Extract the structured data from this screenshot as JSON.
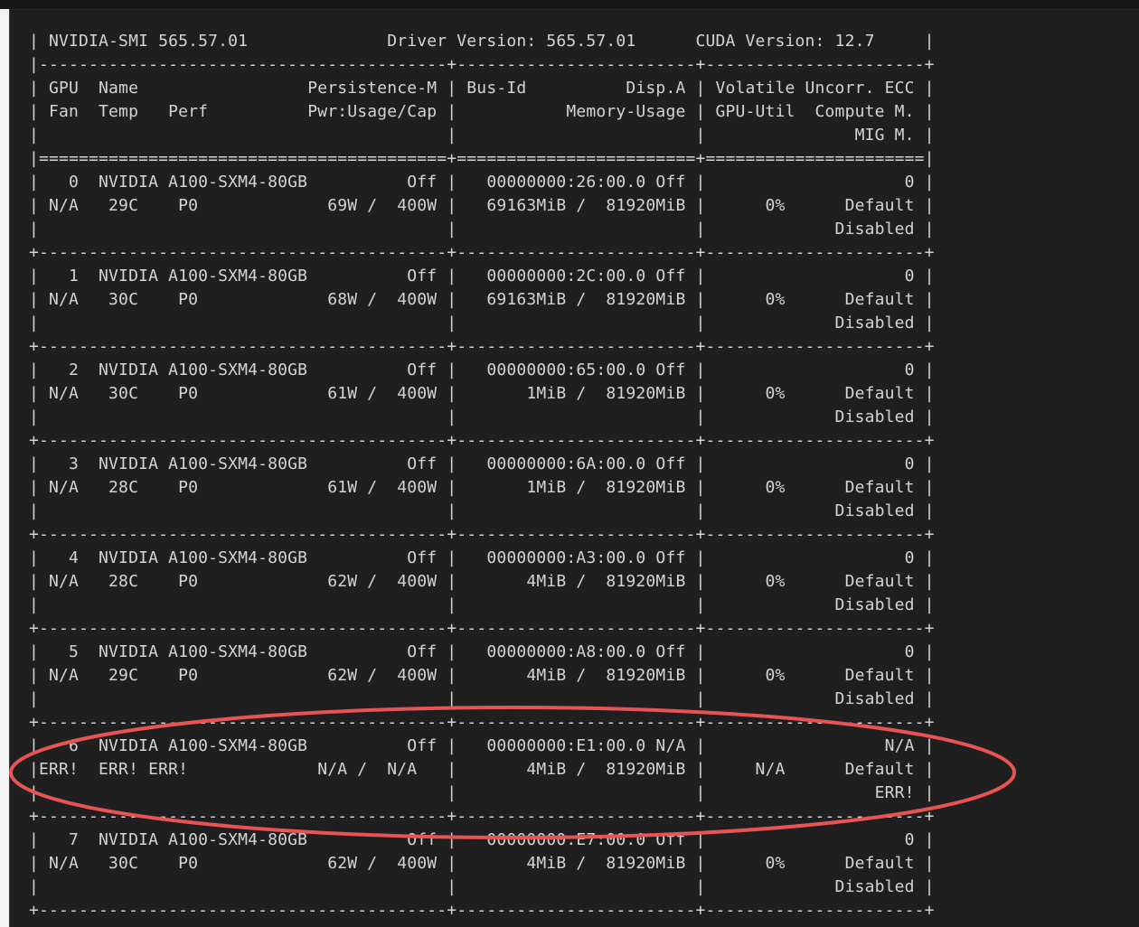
{
  "terminal": {
    "lines": [
      "| NVIDIA-SMI 565.57.01              Driver Version: 565.57.01      CUDA Version: 12.7     |",
      "|-----------------------------------------+------------------------+----------------------+",
      "| GPU  Name                 Persistence-M | Bus-Id          Disp.A | Volatile Uncorr. ECC |",
      "| Fan  Temp   Perf          Pwr:Usage/Cap |           Memory-Usage | GPU-Util  Compute M. |",
      "|                                         |                        |               MIG M. |",
      "|=========================================+========================+======================|",
      "|   0  NVIDIA A100-SXM4-80GB          Off |   00000000:26:00.0 Off |                    0 |",
      "| N/A   29C    P0             69W /  400W |   69163MiB /  81920MiB |      0%      Default |",
      "|                                         |                        |             Disabled |",
      "+-----------------------------------------+------------------------+----------------------+",
      "|   1  NVIDIA A100-SXM4-80GB          Off |   00000000:2C:00.0 Off |                    0 |",
      "| N/A   30C    P0             68W /  400W |   69163MiB /  81920MiB |      0%      Default |",
      "|                                         |                        |             Disabled |",
      "+-----------------------------------------+------------------------+----------------------+",
      "|   2  NVIDIA A100-SXM4-80GB          Off |   00000000:65:00.0 Off |                    0 |",
      "| N/A   30C    P0             61W /  400W |       1MiB /  81920MiB |      0%      Default |",
      "|                                         |                        |             Disabled |",
      "+-----------------------------------------+------------------------+----------------------+",
      "|   3  NVIDIA A100-SXM4-80GB          Off |   00000000:6A:00.0 Off |                    0 |",
      "| N/A   28C    P0             61W /  400W |       1MiB /  81920MiB |      0%      Default |",
      "|                                         |                        |             Disabled |",
      "+-----------------------------------------+------------------------+----------------------+",
      "|   4  NVIDIA A100-SXM4-80GB          Off |   00000000:A3:00.0 Off |                    0 |",
      "| N/A   28C    P0             62W /  400W |       4MiB /  81920MiB |      0%      Default |",
      "|                                         |                        |             Disabled |",
      "+-----------------------------------------+------------------------+----------------------+",
      "|   5  NVIDIA A100-SXM4-80GB          Off |   00000000:A8:00.0 Off |                    0 |",
      "| N/A   29C    P0             62W /  400W |       4MiB /  81920MiB |      0%      Default |",
      "|                                         |                        |             Disabled |",
      "+-----------------------------------------+------------------------+----------------------+",
      "|   6  NVIDIA A100-SXM4-80GB          Off |   00000000:E1:00.0 N/A |                  N/A |",
      "|ERR!  ERR! ERR!             N/A /  N/A   |       4MiB /  81920MiB |     N/A      Default |",
      "|                                         |                        |                 ERR! |",
      "+-----------------------------------------+------------------------+----------------------+",
      "|   7  NVIDIA A100-SXM4-80GB          Off |   00000000:E7:00.0 Off |                    0 |",
      "| N/A   30C    P0             62W /  400W |       4MiB /  81920MiB |      0%      Default |",
      "|                                         |                        |             Disabled |",
      "+-----------------------------------------+------------------------+----------------------+"
    ]
  },
  "annotation": {
    "shape": "ellipse",
    "color": "#e85454",
    "target": "GPU 6 row"
  }
}
